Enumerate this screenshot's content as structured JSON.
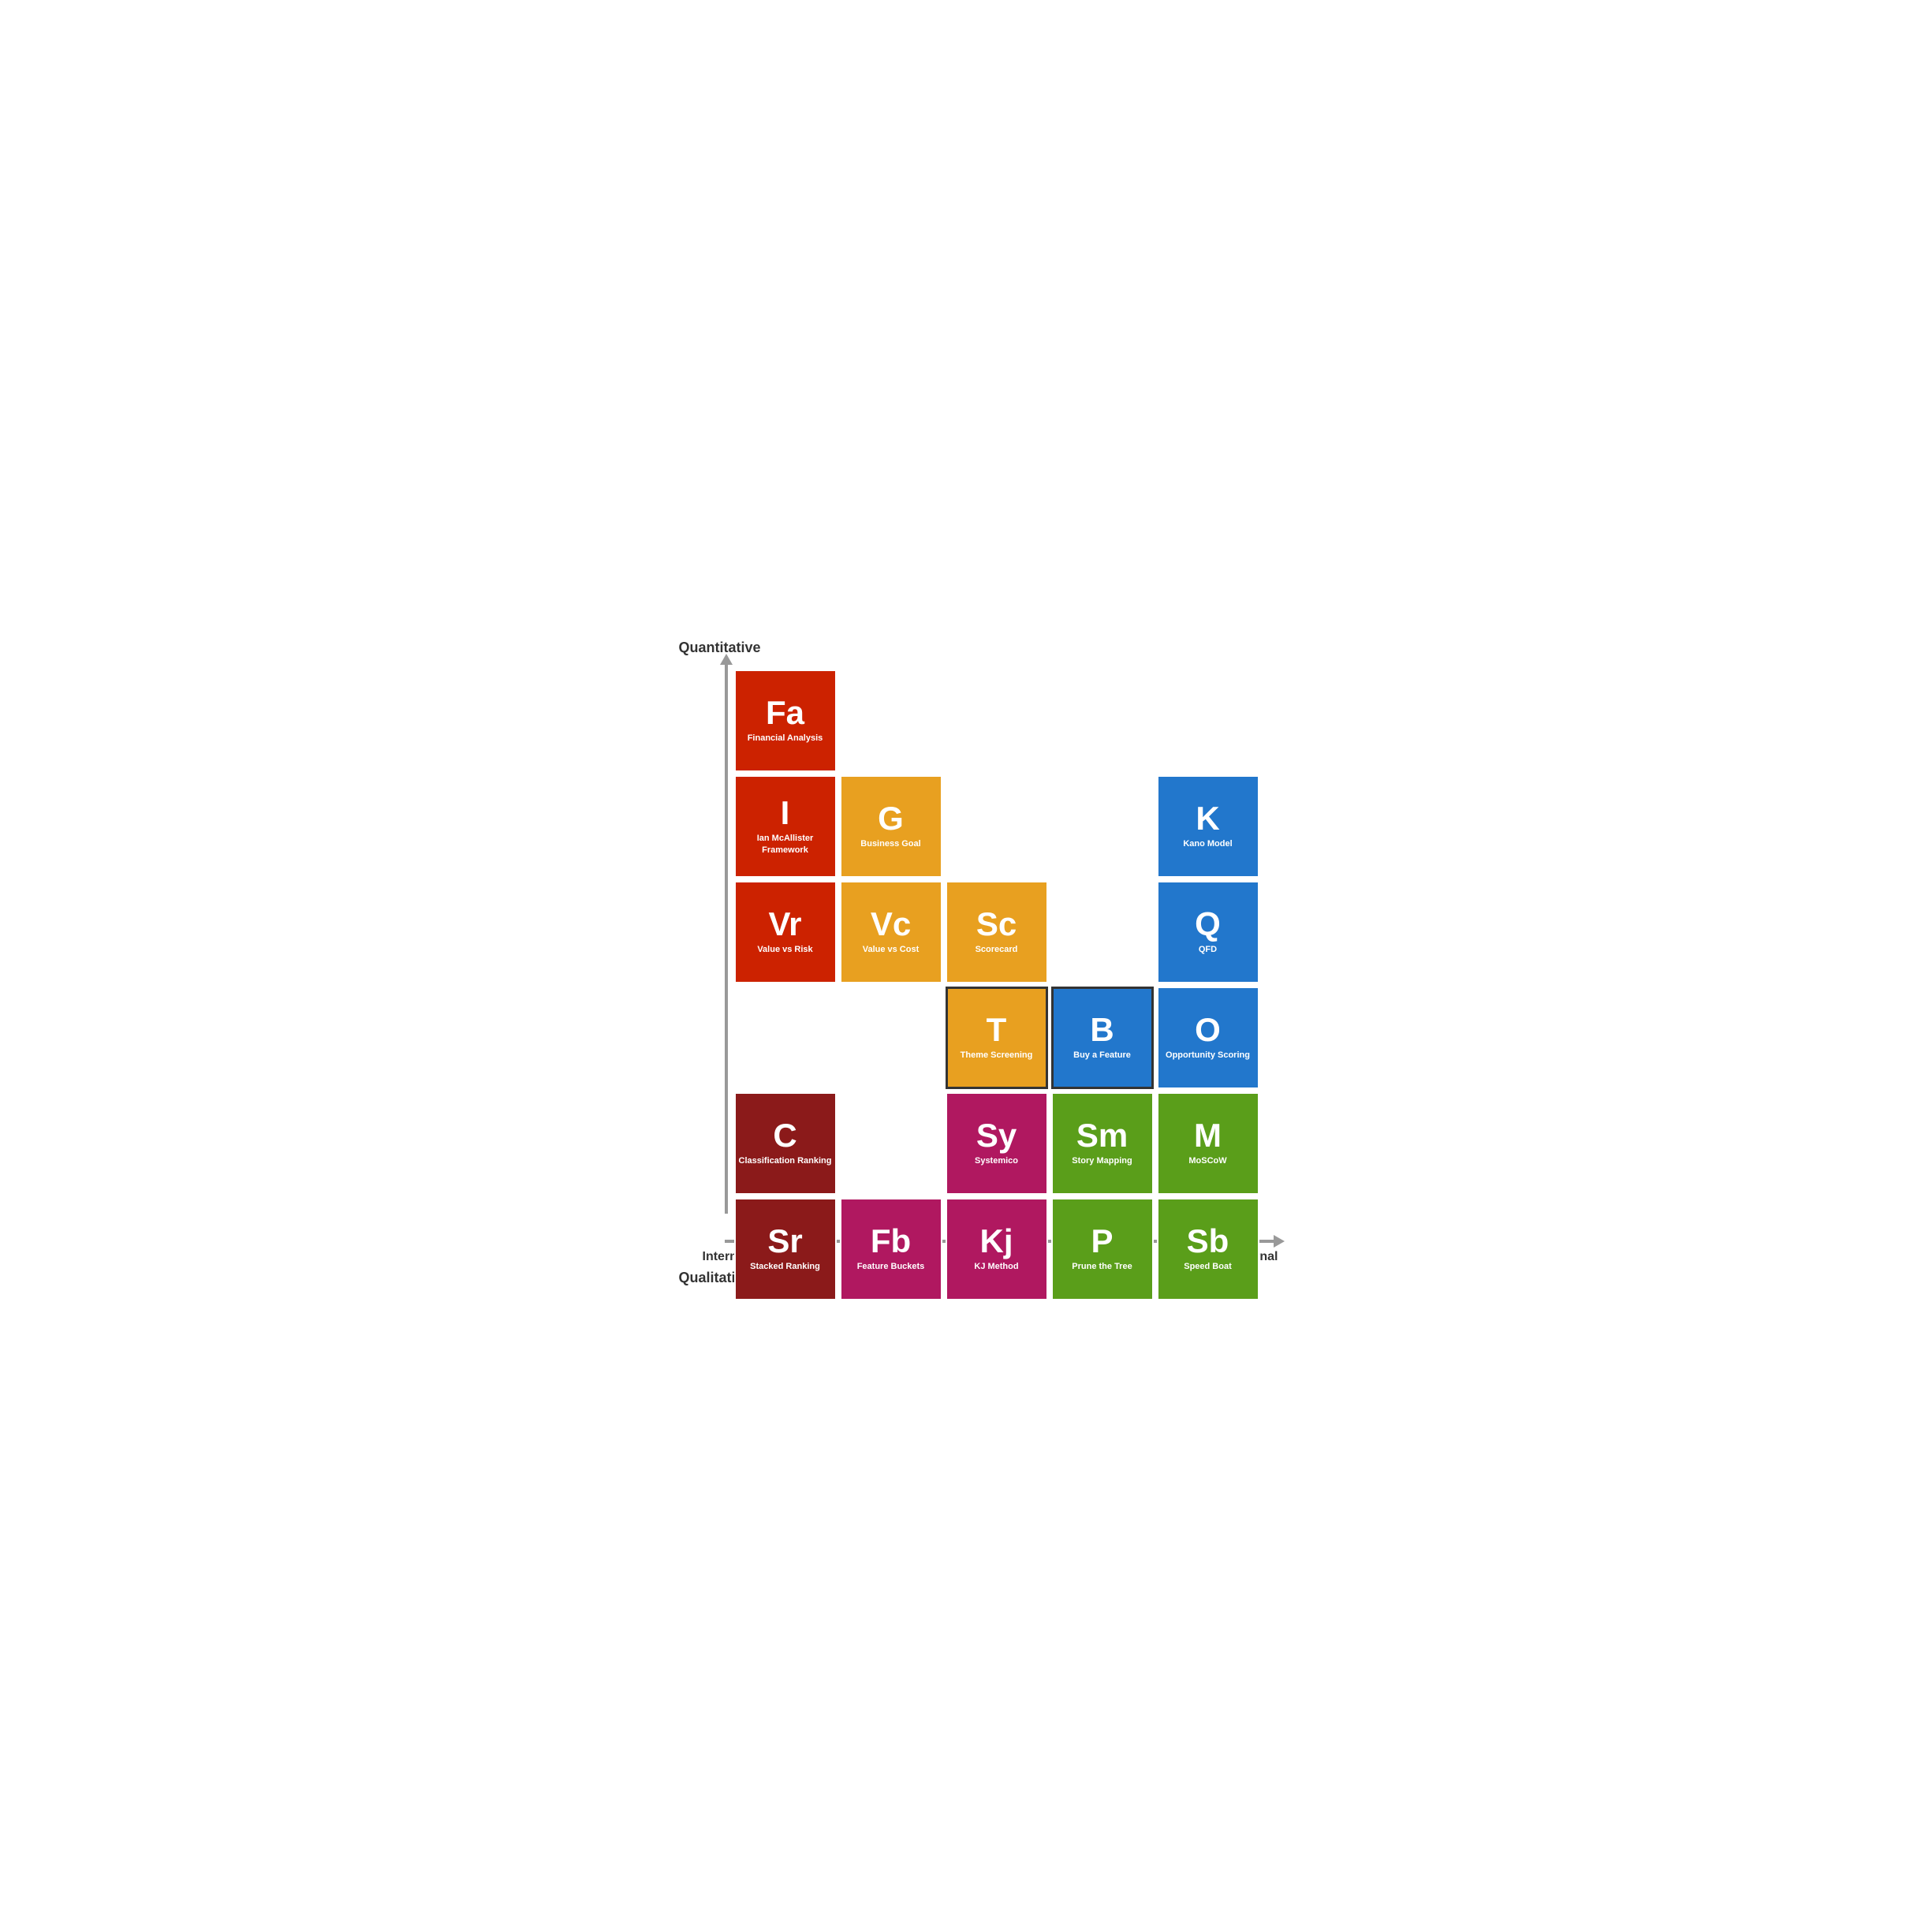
{
  "axes": {
    "quantitative": "Quantitative",
    "qualitative": "Qualitative",
    "internal": "Internal",
    "external": "External"
  },
  "cells": [
    {
      "id": "fa",
      "abbr": "Fa",
      "name": "Financial\nAnalysis",
      "color": "red",
      "col": 0,
      "row": 0
    },
    {
      "id": "i",
      "abbr": "I",
      "name": "Ian McAllister\nFramework",
      "color": "red",
      "col": 0,
      "row": 1
    },
    {
      "id": "g",
      "abbr": "G",
      "name": "Business Goal",
      "color": "orange",
      "col": 1,
      "row": 1
    },
    {
      "id": "vr",
      "abbr": "Vr",
      "name": "Value vs Risk",
      "color": "red",
      "col": 0,
      "row": 2
    },
    {
      "id": "vc",
      "abbr": "Vc",
      "name": "Value vs Cost",
      "color": "orange",
      "col": 1,
      "row": 2
    },
    {
      "id": "sc",
      "abbr": "Sc",
      "name": "Scorecard",
      "color": "orange",
      "col": 2,
      "row": 2
    },
    {
      "id": "k",
      "abbr": "K",
      "name": "Kano Model",
      "color": "blue",
      "col": 4,
      "row": 1
    },
    {
      "id": "q",
      "abbr": "Q",
      "name": "QFD",
      "color": "blue",
      "col": 4,
      "row": 2
    },
    {
      "id": "t",
      "abbr": "T",
      "name": "Theme\nScreening",
      "color": "orange",
      "col": 2,
      "row": 3
    },
    {
      "id": "b",
      "abbr": "B",
      "name": "Buy a\nFeature",
      "color": "blue",
      "col": 3,
      "row": 3
    },
    {
      "id": "o",
      "abbr": "O",
      "name": "Opportunity\nScoring",
      "color": "blue",
      "col": 4,
      "row": 3
    },
    {
      "id": "c",
      "abbr": "C",
      "name": "Classification\nRanking",
      "color": "dark-red",
      "col": 0,
      "row": 4
    },
    {
      "id": "sy",
      "abbr": "Sy",
      "name": "Systemico",
      "color": "pink",
      "col": 2,
      "row": 4
    },
    {
      "id": "sm",
      "abbr": "Sm",
      "name": "Story\nMapping",
      "color": "green",
      "col": 3,
      "row": 4
    },
    {
      "id": "m",
      "abbr": "M",
      "name": "MoSCoW",
      "color": "green",
      "col": 4,
      "row": 4
    },
    {
      "id": "sr",
      "abbr": "Sr",
      "name": "Stacked\nRanking",
      "color": "dark-red",
      "col": 0,
      "row": 5
    },
    {
      "id": "fb",
      "abbr": "Fb",
      "name": "Feature\nBuckets",
      "color": "pink",
      "col": 1,
      "row": 5
    },
    {
      "id": "kj",
      "abbr": "Kj",
      "name": "KJ Method",
      "color": "pink",
      "col": 2,
      "row": 5
    },
    {
      "id": "p",
      "abbr": "P",
      "name": "Prune the\nTree",
      "color": "green",
      "col": 3,
      "row": 5
    },
    {
      "id": "sb",
      "abbr": "Sb",
      "name": "Speed Boat",
      "color": "green",
      "col": 4,
      "row": 5
    }
  ]
}
